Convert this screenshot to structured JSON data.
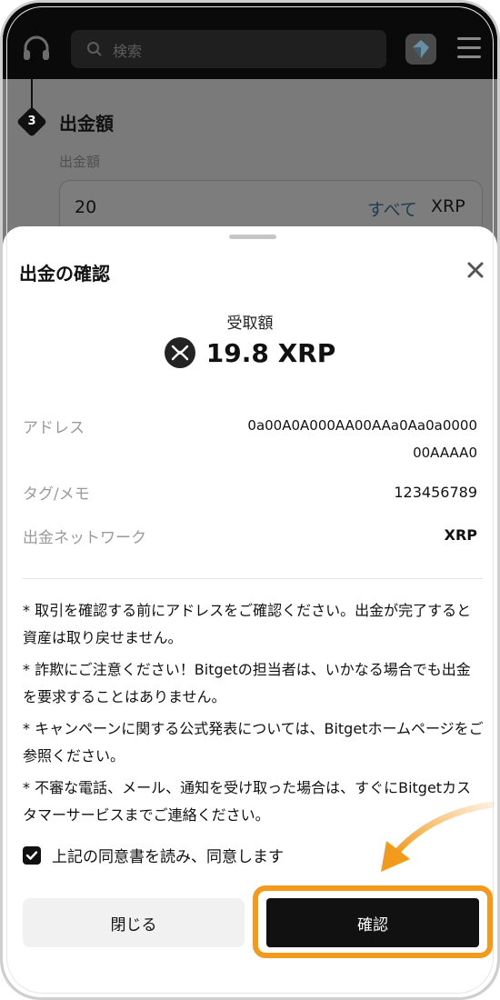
{
  "header": {
    "search_placeholder": "検索"
  },
  "background_form": {
    "step_number": "3",
    "step_title": "出金額",
    "amount_label": "出金額",
    "amount_value": "20",
    "all_button": "すべて",
    "unit": "XRP"
  },
  "sheet": {
    "title": "出金の確認",
    "receive_label": "受取額",
    "receive_amount": "19.8 XRP",
    "address_key": "アドレス",
    "address_line1": "0a00A0A000AA00AAa0Aa0a0000",
    "address_line2": "00AAAA0",
    "tag_key": "タグ/メモ",
    "tag_value": "123456789",
    "network_key": "出金ネットワーク",
    "network_value": "XRP",
    "notes": [
      "* 取引を確認する前にアドレスをご確認ください。出金が完了すると資産は取り戻せません。",
      "* 詐欺にご注意ください！Bitgetの担当者は、いかなる場合でも出金を要求することはありません。",
      "* キャンペーンに関する公式発表については、Bitgetホームページをご参照ください。",
      "* 不審な電話、メール、通知を受け取った場合は、すぐにBitgetカスタマーサービスまでご連絡ください。"
    ],
    "agree_text": "上記の同意書を読み、同意します",
    "agree_checked": true,
    "close_button": "閉じる",
    "confirm_button": "確認"
  },
  "colors": {
    "highlight": "#f29a1c",
    "overlay": "#7a7a7a",
    "primary": "#111111"
  }
}
